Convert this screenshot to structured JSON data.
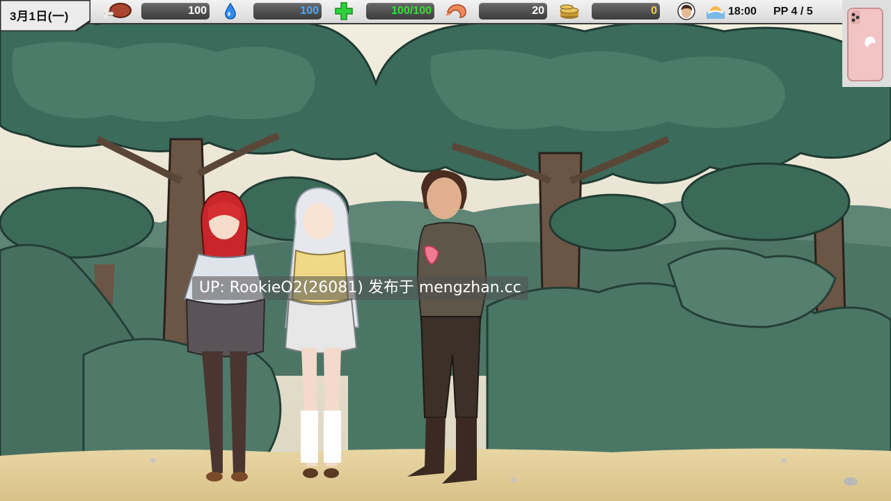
{
  "hud": {
    "date": "3月1日(一)",
    "food": {
      "icon": "roast-meat-icon",
      "value": "100",
      "color": "#ffffff"
    },
    "water": {
      "icon": "water-drop-icon",
      "value": "100",
      "color": "#4aa6ff"
    },
    "health": {
      "icon": "green-cross-icon",
      "value": "100/100",
      "color": "#35e035"
    },
    "shrimp": {
      "icon": "shrimp-icon",
      "value": "20",
      "color": "#ffffff"
    },
    "coins": {
      "icon": "coin-stack-icon",
      "value": "0",
      "color": "#f2d13a"
    },
    "time": "18:00",
    "pp": "PP 4 / 5"
  },
  "overlay": {
    "watermark": "UP: RookieO2(26081) 发布于 mengzhan.cc"
  },
  "colors": {
    "sky": "#eee9d8",
    "tree_dark": "#2e5a4c",
    "tree_mid": "#3f6f5d",
    "ground": "#e3cf9a",
    "hud_bar": "#4a4a4a"
  }
}
